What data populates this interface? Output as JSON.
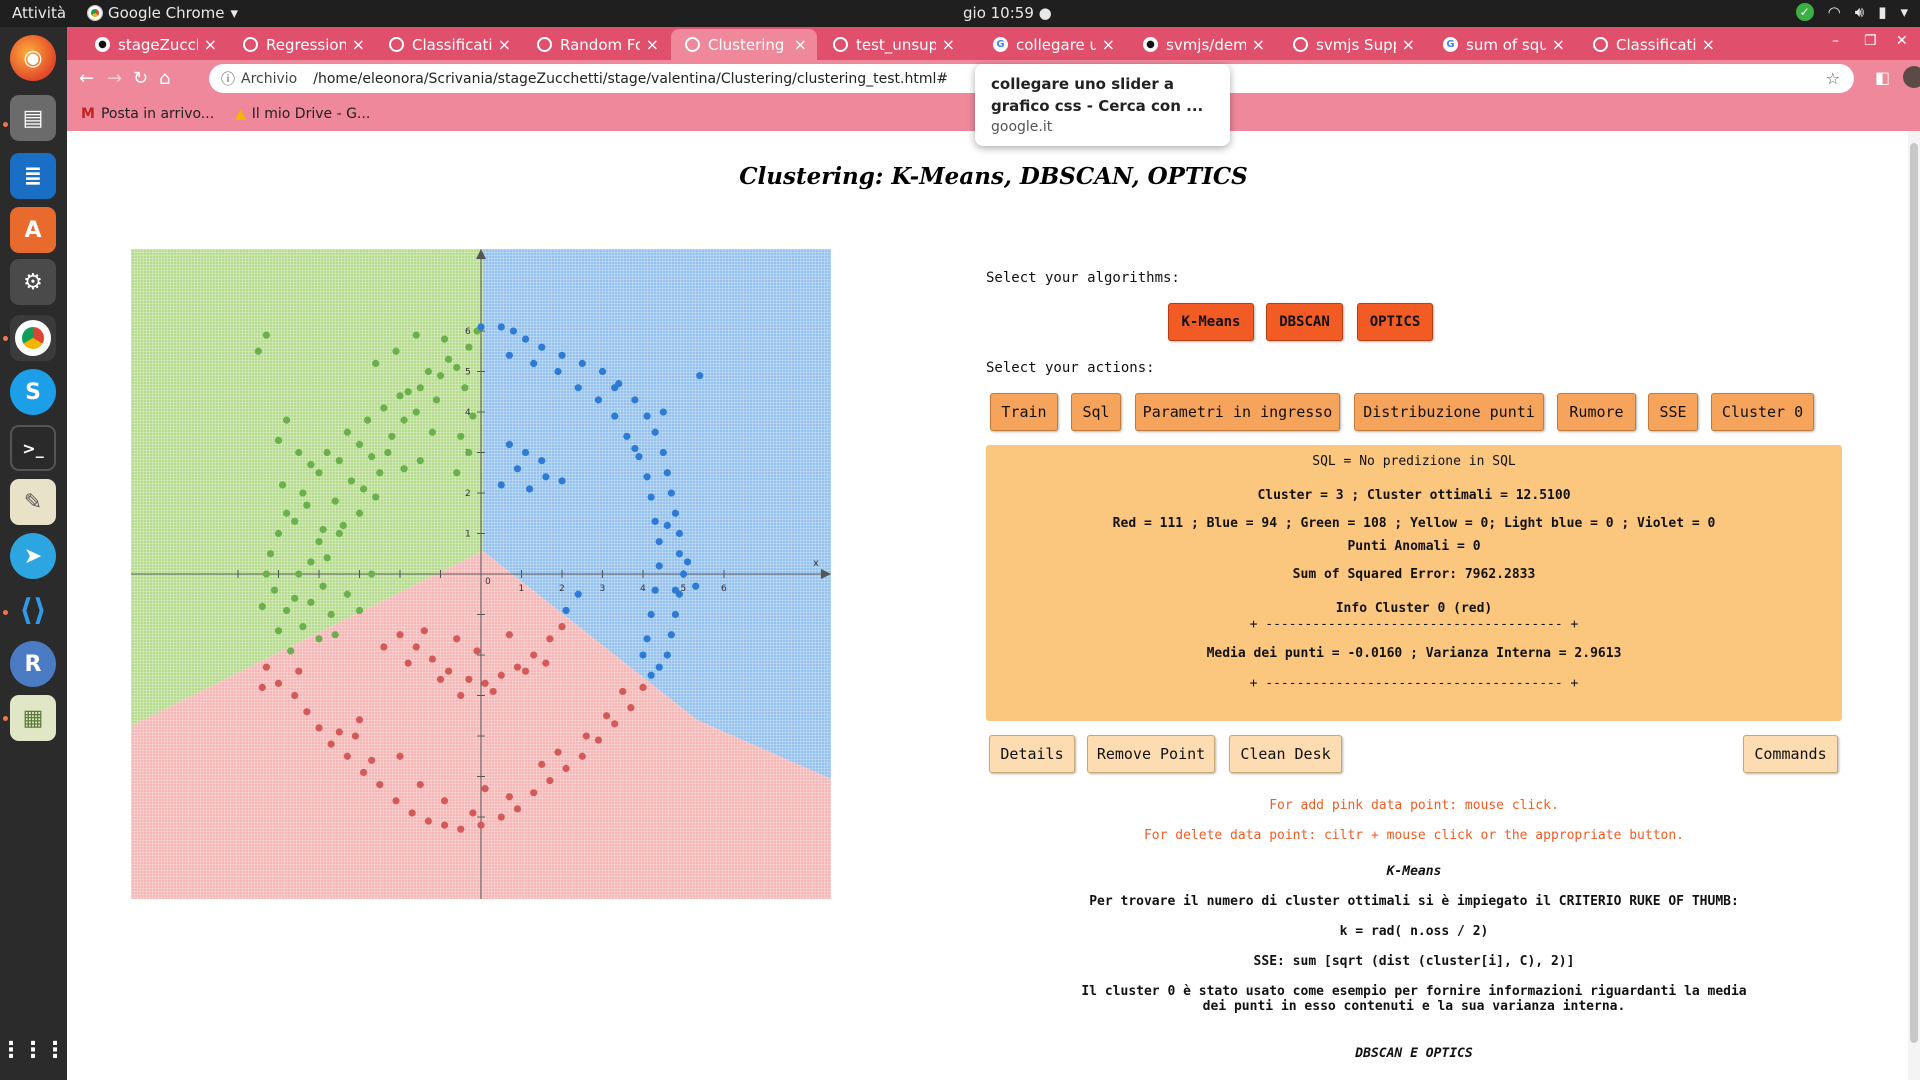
{
  "os": {
    "activities": "Attività",
    "app_name": "Google Chrome",
    "clock": "gio 10:59 ●"
  },
  "tabs": [
    {
      "title": "stageZucche",
      "icon": "github-icon"
    },
    {
      "title": "Regression",
      "icon": "page-icon"
    },
    {
      "title": "Classificatio",
      "icon": "page-icon"
    },
    {
      "title": "Random For",
      "icon": "page-icon"
    },
    {
      "title": "Clustering",
      "icon": "page-icon",
      "active": true
    },
    {
      "title": "test_unsupe",
      "icon": "page-icon"
    },
    {
      "title": "collegare un",
      "icon": "google-icon"
    },
    {
      "title": "svmjs/demo",
      "icon": "github-icon"
    },
    {
      "title": "svmjs Suppo",
      "icon": "page-icon"
    },
    {
      "title": "sum of squa",
      "icon": "google-icon"
    },
    {
      "title": "Classificatio",
      "icon": "page-icon"
    }
  ],
  "address": {
    "label": "Archivio",
    "url": "/home/eleonora/Scrivania/stageZucchetti/stage/valentina/Clustering/clustering_test.html#"
  },
  "bookmarks": [
    "Posta in arrivo...",
    "Il mio Drive - G..."
  ],
  "tooltip": {
    "title": "collegare uno slider a grafico css - Cerca con ...",
    "domain": "google.it"
  },
  "page": {
    "title": "Clustering: K-Means, DBSCAN, OPTICS",
    "select_algorithms": "Select your algorithms:",
    "algorithms": [
      "K-Means",
      "DBSCAN",
      "OPTICS"
    ],
    "select_actions": "Select your actions:",
    "actions": [
      "Train",
      "Sql",
      "Parametri in ingresso",
      "Distribuzione punti",
      "Rumore",
      "SSE",
      "Cluster 0"
    ],
    "info": {
      "sql": "SQL = No predizione in SQL",
      "cluster": "Cluster = 3 ; Cluster ottimali = 12.5100",
      "colors": "Red = 111 ; Blue = 94 ; Green = 108 ; Yellow = 0; Light blue = 0 ; Violet = 0",
      "anomalies": "Punti Anomali = 0",
      "sse": "Sum of Squared Error: 7962.2833",
      "cluster0": "Info Cluster 0 (red)",
      "sep1": "+ -------------------------------------- +",
      "stats": "Media dei punti = -0.0160 ; Varianza Interna = 2.9613",
      "sep2": "+ -------------------------------------- +"
    },
    "bottom_buttons": [
      "Details",
      "Remove Point",
      "Clean Desk"
    ],
    "commands": "Commands",
    "note_add": "For add pink data point: mouse click.",
    "note_delete": "For delete data point: ciltr + mouse click or the appropriate button.",
    "kmeans_title": "K-Means",
    "kmeans_line1": "Per trovare il numero di cluster ottimali si è impiegato il CRITERIO RUKE OF THUMB:",
    "kmeans_formula": "k = rad( n.oss / 2)",
    "sse_formula": "SSE: sum [sqrt (dist (cluster[i], C), 2)]",
    "cluster0_desc": "Il cluster 0 è stato usato come esempio per fornire informazioni riguardanti la media dei punti in esso contenuti e la sua varianza interna.",
    "dbscan_title": "DBSCAN E OPTICS"
  },
  "chart_data": {
    "type": "scatter",
    "x_ticks": [
      "1",
      "2",
      "3",
      "4",
      "5",
      "6"
    ],
    "y_ticks": [
      "1",
      "2",
      "3",
      "4",
      "5",
      "6"
    ],
    "origin_label": "0",
    "x_axis_label": "x",
    "series": [
      {
        "color": "#6ab04c",
        "points": [
          [
            -5.3,
            5.9
          ],
          [
            -5.5,
            5.5
          ],
          [
            -4.8,
            3.8
          ],
          [
            -5.0,
            3.3
          ],
          [
            -4.5,
            3.0
          ],
          [
            -4.2,
            2.7
          ],
          [
            -3.8,
            3.0
          ],
          [
            -3.3,
            3.5
          ],
          [
            -2.8,
            3.8
          ],
          [
            -2.4,
            4.1
          ],
          [
            -1.8,
            4.5
          ],
          [
            -1.0,
            4.9
          ],
          [
            -0.6,
            5.1
          ],
          [
            -0.3,
            5.6
          ],
          [
            -0.1,
            6.0
          ],
          [
            -0.8,
            5.3
          ],
          [
            -1.5,
            4.6
          ],
          [
            -2.0,
            4.4
          ],
          [
            -3.0,
            3.2
          ],
          [
            -3.5,
            2.8
          ],
          [
            -4.0,
            2.5
          ],
          [
            -4.4,
            2.0
          ],
          [
            -4.8,
            1.5
          ],
          [
            -5.0,
            1.0
          ],
          [
            -5.2,
            0.5
          ],
          [
            -5.3,
            0.0
          ],
          [
            -5.1,
            -0.4
          ],
          [
            -4.8,
            -0.9
          ],
          [
            -4.4,
            -1.3
          ],
          [
            -4.0,
            -1.6
          ],
          [
            -5.0,
            -1.4
          ],
          [
            -4.6,
            -0.6
          ],
          [
            -4.2,
            0.3
          ],
          [
            -3.9,
            1.1
          ],
          [
            -3.6,
            1.8
          ],
          [
            -3.2,
            2.3
          ],
          [
            -2.7,
            2.9
          ],
          [
            -2.2,
            3.4
          ],
          [
            -1.6,
            4.0
          ],
          [
            -1.2,
            3.5
          ],
          [
            -0.6,
            2.5
          ],
          [
            -0.3,
            3.0
          ],
          [
            -1.5,
            2.8
          ],
          [
            -2.5,
            2.5
          ],
          [
            -3.0,
            1.5
          ],
          [
            -3.5,
            1.0
          ],
          [
            -4.0,
            0.8
          ],
          [
            -4.5,
            0.0
          ],
          [
            -4.2,
            -0.7
          ],
          [
            -3.7,
            -1.0
          ],
          [
            -3.3,
            -0.5
          ],
          [
            -3.8,
            0.4
          ],
          [
            -4.6,
            1.3
          ],
          [
            -3.4,
            1.2
          ],
          [
            -2.9,
            2.1
          ],
          [
            -2.3,
            3.0
          ],
          [
            -1.9,
            3.8
          ],
          [
            -1.1,
            4.3
          ],
          [
            -0.4,
            4.6
          ],
          [
            -0.9,
            5.8
          ],
          [
            -1.6,
            5.9
          ],
          [
            -2.1,
            5.5
          ],
          [
            -2.6,
            5.2
          ],
          [
            -1.3,
            5.0
          ],
          [
            -0.2,
            3.9
          ],
          [
            -0.5,
            3.4
          ],
          [
            -1.9,
            2.6
          ],
          [
            -2.6,
            1.9
          ],
          [
            -4.9,
            2.2
          ],
          [
            -4.3,
            1.7
          ],
          [
            -3.9,
            -0.3
          ],
          [
            -4.7,
            -1.9
          ],
          [
            -5.4,
            -0.8
          ],
          [
            -3.6,
            -1.5
          ],
          [
            -3.0,
            -0.9
          ],
          [
            -2.7,
            0.0
          ]
        ]
      },
      {
        "color": "#2e7bd6",
        "points": [
          [
            0.0,
            6.1
          ],
          [
            0.5,
            6.1
          ],
          [
            0.8,
            6.0
          ],
          [
            1.1,
            5.8
          ],
          [
            1.5,
            5.6
          ],
          [
            2.0,
            5.4
          ],
          [
            2.5,
            5.2
          ],
          [
            3.0,
            5.0
          ],
          [
            3.4,
            4.7
          ],
          [
            3.8,
            4.3
          ],
          [
            4.1,
            3.9
          ],
          [
            4.3,
            3.5
          ],
          [
            4.5,
            3.0
          ],
          [
            4.6,
            2.5
          ],
          [
            4.7,
            2.0
          ],
          [
            4.8,
            1.5
          ],
          [
            4.9,
            1.0
          ],
          [
            4.9,
            0.5
          ],
          [
            5.0,
            0.0
          ],
          [
            4.9,
            -0.5
          ],
          [
            4.8,
            -1.0
          ],
          [
            4.7,
            -1.5
          ],
          [
            4.6,
            -2.0
          ],
          [
            4.4,
            -2.3
          ],
          [
            4.2,
            -2.5
          ],
          [
            0.7,
            5.4
          ],
          [
            1.3,
            5.2
          ],
          [
            1.9,
            5.0
          ],
          [
            2.4,
            4.6
          ],
          [
            2.9,
            4.3
          ],
          [
            3.3,
            3.9
          ],
          [
            3.6,
            3.4
          ],
          [
            3.9,
            2.9
          ],
          [
            4.1,
            2.4
          ],
          [
            4.2,
            1.9
          ],
          [
            4.3,
            1.3
          ],
          [
            4.4,
            0.8
          ],
          [
            4.4,
            0.2
          ],
          [
            4.3,
            -0.4
          ],
          [
            4.2,
            -1.0
          ],
          [
            4.1,
            -1.6
          ],
          [
            4.0,
            -2.0
          ],
          [
            0.7,
            3.2
          ],
          [
            1.1,
            3.0
          ],
          [
            1.5,
            2.8
          ],
          [
            0.9,
            2.6
          ],
          [
            1.6,
            2.4
          ],
          [
            0.5,
            2.2
          ],
          [
            1.2,
            2.1
          ],
          [
            2.0,
            2.3
          ],
          [
            5.4,
            4.9
          ],
          [
            5.3,
            -0.3
          ],
          [
            2.4,
            -0.5
          ],
          [
            3.3,
            4.6
          ],
          [
            3.8,
            3.1
          ],
          [
            4.5,
            4.0
          ],
          [
            4.6,
            1.2
          ],
          [
            4.8,
            -0.4
          ],
          [
            5.1,
            0.3
          ],
          [
            2.1,
            -0.9
          ]
        ]
      },
      {
        "color": "#d45a5a",
        "points": [
          [
            -5.3,
            -2.3
          ],
          [
            -5.0,
            -2.7
          ],
          [
            -4.6,
            -3.0
          ],
          [
            -4.3,
            -3.4
          ],
          [
            -4.0,
            -3.8
          ],
          [
            -3.7,
            -4.2
          ],
          [
            -3.3,
            -4.5
          ],
          [
            -2.9,
            -4.9
          ],
          [
            -2.5,
            -5.2
          ],
          [
            -2.1,
            -5.6
          ],
          [
            -1.7,
            -5.9
          ],
          [
            -1.3,
            -6.1
          ],
          [
            -0.9,
            -6.2
          ],
          [
            -0.5,
            -6.3
          ],
          [
            0.0,
            -6.2
          ],
          [
            0.5,
            -6.0
          ],
          [
            0.9,
            -5.8
          ],
          [
            1.3,
            -5.4
          ],
          [
            1.7,
            -5.1
          ],
          [
            2.1,
            -4.8
          ],
          [
            2.5,
            -4.5
          ],
          [
            2.9,
            -4.1
          ],
          [
            3.3,
            -3.7
          ],
          [
            3.7,
            -3.3
          ],
          [
            4.0,
            -2.8
          ],
          [
            -2.0,
            -1.5
          ],
          [
            -1.6,
            -1.8
          ],
          [
            -1.2,
            -2.1
          ],
          [
            -0.8,
            -2.4
          ],
          [
            -0.3,
            -2.6
          ],
          [
            0.1,
            -2.7
          ],
          [
            0.5,
            -2.5
          ],
          [
            0.9,
            -2.3
          ],
          [
            1.3,
            -2.0
          ],
          [
            1.7,
            -1.6
          ],
          [
            2.0,
            -1.3
          ],
          [
            -1.8,
            -2.2
          ],
          [
            -1.0,
            -2.6
          ],
          [
            -0.5,
            -3.0
          ],
          [
            0.3,
            -2.9
          ],
          [
            1.1,
            -2.4
          ],
          [
            1.6,
            -2.2
          ],
          [
            -2.4,
            -1.8
          ],
          [
            -3.0,
            -3.6
          ],
          [
            -3.5,
            -3.9
          ],
          [
            -2.0,
            -4.5
          ],
          [
            -1.5,
            -5.2
          ],
          [
            -0.9,
            -5.6
          ],
          [
            0.1,
            -5.3
          ],
          [
            0.7,
            -5.5
          ],
          [
            1.5,
            -4.7
          ],
          [
            2.6,
            -4.0
          ],
          [
            3.1,
            -3.5
          ],
          [
            3.5,
            -2.9
          ],
          [
            -5.4,
            -2.8
          ],
          [
            -4.5,
            -2.4
          ],
          [
            -3.1,
            -4.0
          ],
          [
            -2.7,
            -4.6
          ],
          [
            -0.2,
            -5.9
          ],
          [
            1.9,
            -4.4
          ],
          [
            -0.1,
            -1.9
          ],
          [
            -0.6,
            -1.6
          ],
          [
            0.7,
            -1.5
          ],
          [
            -1.4,
            -1.4
          ]
        ]
      }
    ]
  }
}
